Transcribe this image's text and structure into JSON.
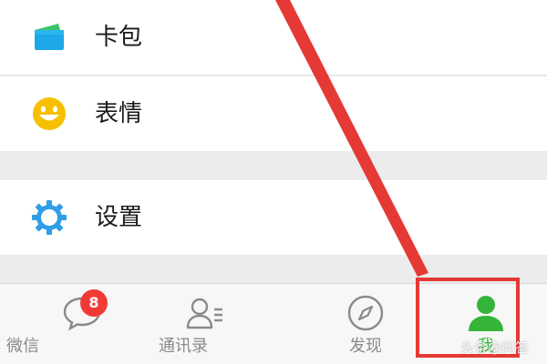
{
  "menu": {
    "items": [
      {
        "label": "卡包",
        "icon": "card-wallet-icon"
      },
      {
        "label": "表情",
        "icon": "smiley-icon"
      },
      {
        "label": "设置",
        "icon": "gear-icon"
      }
    ]
  },
  "tabbar": {
    "tabs": [
      {
        "label": "微信",
        "icon": "chat-bubble-icon",
        "badge": "8"
      },
      {
        "label": "通讯录",
        "icon": "contacts-icon"
      },
      {
        "label": "发现",
        "icon": "compass-icon"
      },
      {
        "label": "我",
        "icon": "person-icon",
        "active": true
      }
    ]
  },
  "colors": {
    "active_green": "#34b53a",
    "badge_red": "#f23a35",
    "annotation_red": "#e53935",
    "wallet_blue": "#1ea7e8",
    "smiley_yellow": "#f6c000",
    "gear_blue": "#2f9ee6"
  },
  "watermark": "头条@问答"
}
